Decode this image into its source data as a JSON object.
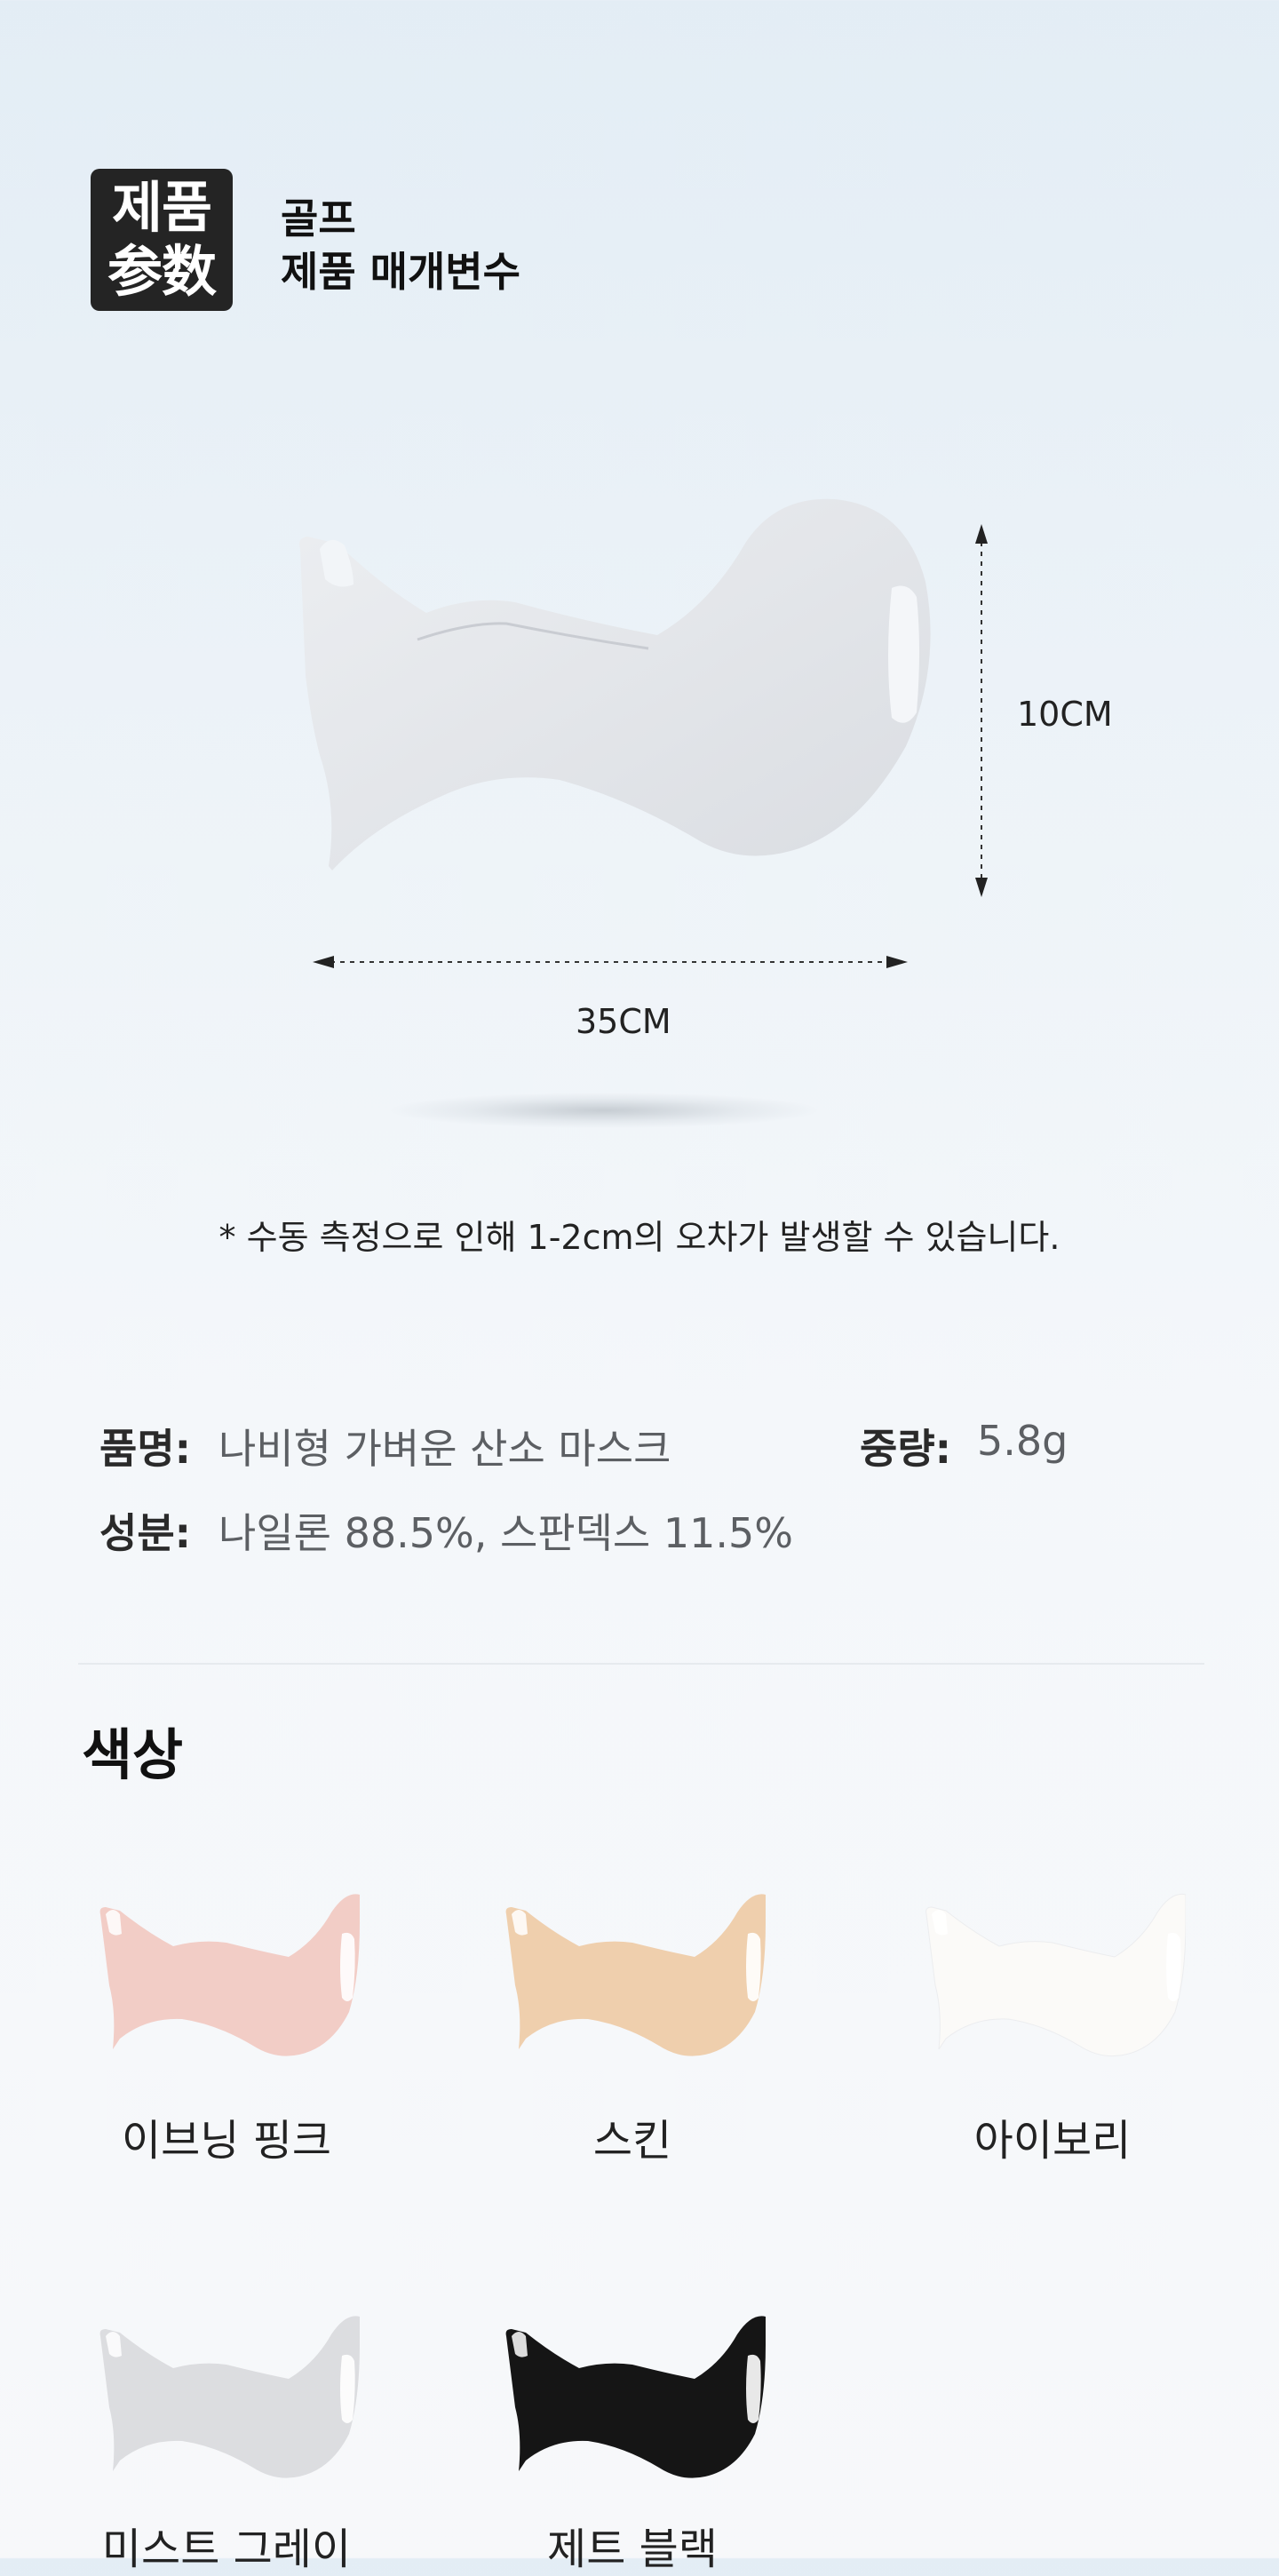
{
  "header": {
    "badge_line1": "제품",
    "badge_line2": "参数",
    "subtitle_line1": "골프",
    "subtitle_line2": "제품 매개변수"
  },
  "dimensions": {
    "height_label": "10CM",
    "width_label": "35CM",
    "note": "* 수동 측정으로 인해 1-2cm의 오차가 발생할 수 있습니다."
  },
  "specs": {
    "name_key": "품명:",
    "name_value": "나비형 가벼운 산소 마스크",
    "weight_key": "중량:",
    "weight_value": "5.8g",
    "material_key": "성분:",
    "material_value": "나일론 88.5%, 스판덱스 11.5%"
  },
  "colors": {
    "section_title": "색상",
    "items": [
      {
        "label": "이브닝 핑크",
        "hex": "#f2cdc6"
      },
      {
        "label": "스킨",
        "hex": "#efcfad"
      },
      {
        "label": "아이보리",
        "hex": "#fbfaf8"
      },
      {
        "label": "미스트 그레이",
        "hex": "#dcdde0"
      },
      {
        "label": "제트 블랙",
        "hex": "#151515"
      }
    ]
  },
  "main_mask_color": "#e6e8ec"
}
